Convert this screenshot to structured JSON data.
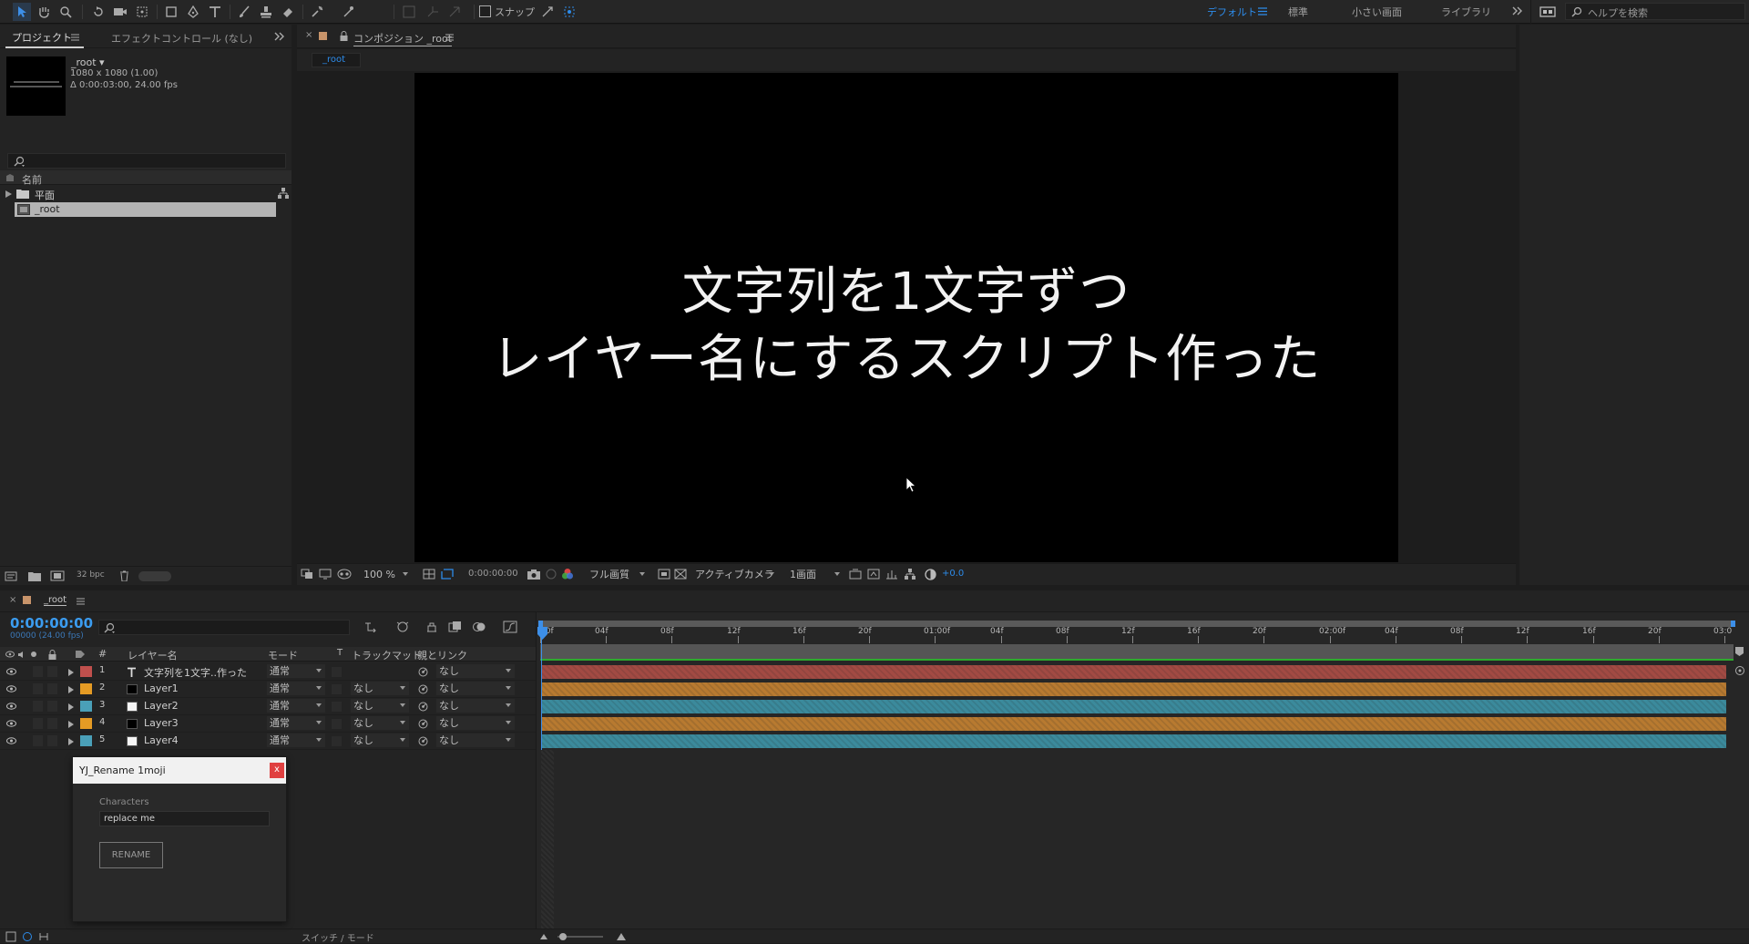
{
  "toolbar": {
    "snap_label": "スナップ",
    "workspaces": [
      "デフォルト",
      "標準",
      "小さい画面",
      "ライブラリ"
    ],
    "search_placeholder": "ヘルプを検索"
  },
  "project_panel": {
    "tab_project": "プロジェクト",
    "tab_effects": "エフェクトコントロール (なし)",
    "item_name": "_root ▾",
    "item_size": "1080 x 1080 (1.00)",
    "item_duration": "Δ 0:00:03:00, 24.00 fps",
    "column_name": "名前",
    "items": [
      {
        "name": "平面",
        "type": "folder"
      },
      {
        "name": "_root",
        "type": "comp"
      }
    ],
    "bpc": "32 bpc"
  },
  "comp_panel": {
    "tab_label": "コンポジション _root",
    "subtab": "_root",
    "text_line1": "文字列を1文字ずつ",
    "text_line2": "レイヤー名にするスクリプト作った",
    "zoom": "100 %",
    "timecode": "0:00:00:00",
    "quality": "フル画質",
    "camera": "アクティブカメラ",
    "views": "1画面",
    "exposure": "+0.0"
  },
  "timeline": {
    "tab_label": "_root",
    "timecode": "0:00:00:00",
    "frame_info": "00000 (24.00 fps)",
    "col_num": "#",
    "col_layer_name": "レイヤー名",
    "col_mode": "モード",
    "col_t": "T",
    "col_trackmatte": "トラックマット",
    "col_parent": "親とリンク",
    "ruler_ticks": [
      "00f",
      "04f",
      "08f",
      "12f",
      "16f",
      "20f",
      "01:00f",
      "04f",
      "08f",
      "12f",
      "16f",
      "20f",
      "02:00f",
      "04f",
      "08f",
      "12f",
      "16f",
      "20f",
      "03:0"
    ],
    "layers": [
      {
        "num": "1",
        "name": "文字列を1文字..作った",
        "mode": "通常",
        "matte": "",
        "parent": "なし",
        "label_color": "#c0504d",
        "icon": "text-icon",
        "bar_color": "#a24a43"
      },
      {
        "num": "2",
        "name": "Layer1",
        "mode": "通常",
        "matte": "なし",
        "parent": "なし",
        "label_color": "#e59b24",
        "icon": "black-solid-icon",
        "bar_color": "#b87a30"
      },
      {
        "num": "3",
        "name": "Layer2",
        "mode": "通常",
        "matte": "なし",
        "parent": "なし",
        "label_color": "#4aa0b8",
        "icon": "white-solid-icon",
        "bar_color": "#3b8a9c"
      },
      {
        "num": "4",
        "name": "Layer3",
        "mode": "通常",
        "matte": "なし",
        "parent": "なし",
        "label_color": "#e59b24",
        "icon": "black-solid-icon",
        "bar_color": "#b87a30"
      },
      {
        "num": "5",
        "name": "Layer4",
        "mode": "通常",
        "matte": "なし",
        "parent": "なし",
        "label_color": "#4aa0b8",
        "icon": "white-solid-icon",
        "bar_color": "#3b8a9c"
      }
    ],
    "bottom_label": "スイッチ / モード"
  },
  "script_panel": {
    "title": "YJ_Rename 1moji",
    "close": "x",
    "field_label": "Characters",
    "field_value": "replace me",
    "button_label": "RENAME"
  },
  "colors": {
    "accent": "#2d8ceb",
    "timecode": "#3b9cf0"
  }
}
